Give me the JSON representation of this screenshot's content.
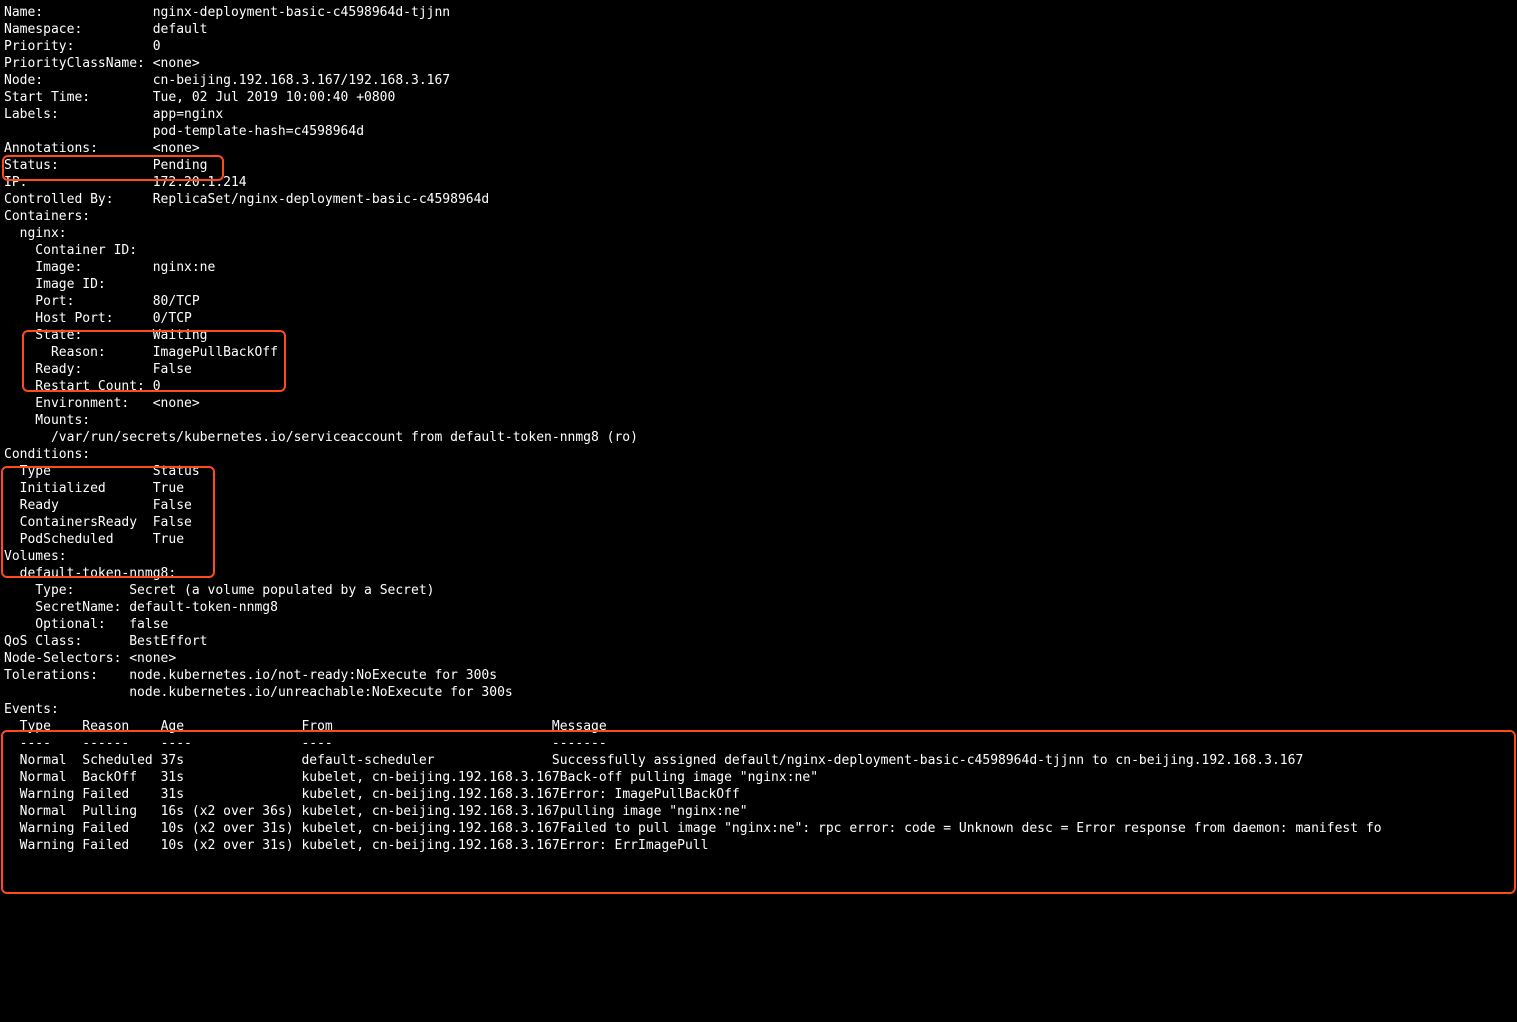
{
  "header": {
    "fields": [
      {
        "label": "Name:",
        "value": "nginx-deployment-basic-c4598964d-tjjnn"
      },
      {
        "label": "Namespace:",
        "value": "default"
      },
      {
        "label": "Priority:",
        "value": "0"
      },
      {
        "label": "PriorityClassName:",
        "value": "<none>"
      },
      {
        "label": "Node:",
        "value": "cn-beijing.192.168.3.167/192.168.3.167"
      },
      {
        "label": "Start Time:",
        "value": "Tue, 02 Jul 2019 10:00:40 +0800"
      },
      {
        "label": "Labels:",
        "value": "app=nginx"
      },
      {
        "label": "",
        "value": "pod-template-hash=c4598964d"
      },
      {
        "label": "Annotations:",
        "value": "<none>"
      },
      {
        "label": "Status:",
        "value": "Pending"
      },
      {
        "label": "IP:",
        "value": "172.20.1.214"
      },
      {
        "label": "Controlled By:",
        "value": "ReplicaSet/nginx-deployment-basic-c4598964d"
      }
    ]
  },
  "containers": {
    "header": "Containers:",
    "name": "  nginx:",
    "rows": [
      {
        "label": "    Container ID:",
        "value": ""
      },
      {
        "label": "    Image:",
        "value": "nginx:ne"
      },
      {
        "label": "    Image ID:",
        "value": ""
      },
      {
        "label": "    Port:",
        "value": "80/TCP"
      },
      {
        "label": "    Host Port:",
        "value": "0/TCP"
      },
      {
        "label": "    State:",
        "value": "Waiting"
      },
      {
        "label": "      Reason:",
        "value": "ImagePullBackOff"
      },
      {
        "label": "    Ready:",
        "value": "False"
      },
      {
        "label": "    Restart Count:",
        "value": "0"
      },
      {
        "label": "    Environment:",
        "value": "<none>"
      },
      {
        "label": "    Mounts:",
        "value": ""
      }
    ],
    "mount_line": "      /var/run/secrets/kubernetes.io/serviceaccount from default-token-nnmg8 (ro)"
  },
  "conditions": {
    "header": "Conditions:",
    "cols": {
      "type": "  Type",
      "status": "Status"
    },
    "rows": [
      {
        "type": "  Initialized",
        "status": "True"
      },
      {
        "type": "  Ready",
        "status": "False"
      },
      {
        "type": "  ContainersReady",
        "status": "False"
      },
      {
        "type": "  PodScheduled",
        "status": "True"
      }
    ]
  },
  "volumes": {
    "header": "Volumes:",
    "name": "  default-token-nnmg8:",
    "rows": [
      {
        "label": "    Type:",
        "value": "Secret (a volume populated by a Secret)"
      },
      {
        "label": "    SecretName:",
        "value": "default-token-nnmg8"
      },
      {
        "label": "    Optional:",
        "value": "false"
      }
    ]
  },
  "footer": {
    "rows": [
      {
        "label": "QoS Class:",
        "value": "BestEffort"
      },
      {
        "label": "Node-Selectors:",
        "value": "<none>"
      },
      {
        "label": "Tolerations:",
        "value": "node.kubernetes.io/not-ready:NoExecute for 300s"
      },
      {
        "label": "",
        "value": "node.kubernetes.io/unreachable:NoExecute for 300s"
      }
    ]
  },
  "events": {
    "header": "Events:",
    "cols": {
      "type": "  Type",
      "reason": "Reason",
      "age": "Age",
      "from": "From",
      "message": "Message"
    },
    "dashes": {
      "type": "  ----",
      "reason": "------",
      "age": "----",
      "from": "----",
      "message": "-------"
    },
    "rows": [
      {
        "type": "  Normal",
        "reason": "Scheduled",
        "age": "37s",
        "from": "default-scheduler",
        "message": "Successfully assigned default/nginx-deployment-basic-c4598964d-tjjnn to cn-beijing.192.168.3.167"
      },
      {
        "type": "  Normal",
        "reason": "BackOff",
        "age": "31s",
        "from": "kubelet, cn-beijing.192.168.3.167",
        "message": "Back-off pulling image \"nginx:ne\""
      },
      {
        "type": "  Warning",
        "reason": "Failed",
        "age": "31s",
        "from": "kubelet, cn-beijing.192.168.3.167",
        "message": "Error: ImagePullBackOff"
      },
      {
        "type": "  Normal",
        "reason": "Pulling",
        "age": "16s (x2 over 36s)",
        "from": "kubelet, cn-beijing.192.168.3.167",
        "message": "pulling image \"nginx:ne\""
      },
      {
        "type": "  Warning",
        "reason": "Failed",
        "age": "10s (x2 over 31s)",
        "from": "kubelet, cn-beijing.192.168.3.167",
        "message": "Failed to pull image \"nginx:ne\": rpc error: code = Unknown desc = Error response from daemon: manifest fo"
      },
      {
        "type": "  Warning",
        "reason": "Failed",
        "age": "10s (x2 over 31s)",
        "from": "kubelet, cn-beijing.192.168.3.167",
        "message": "Error: ErrImagePull"
      }
    ]
  }
}
